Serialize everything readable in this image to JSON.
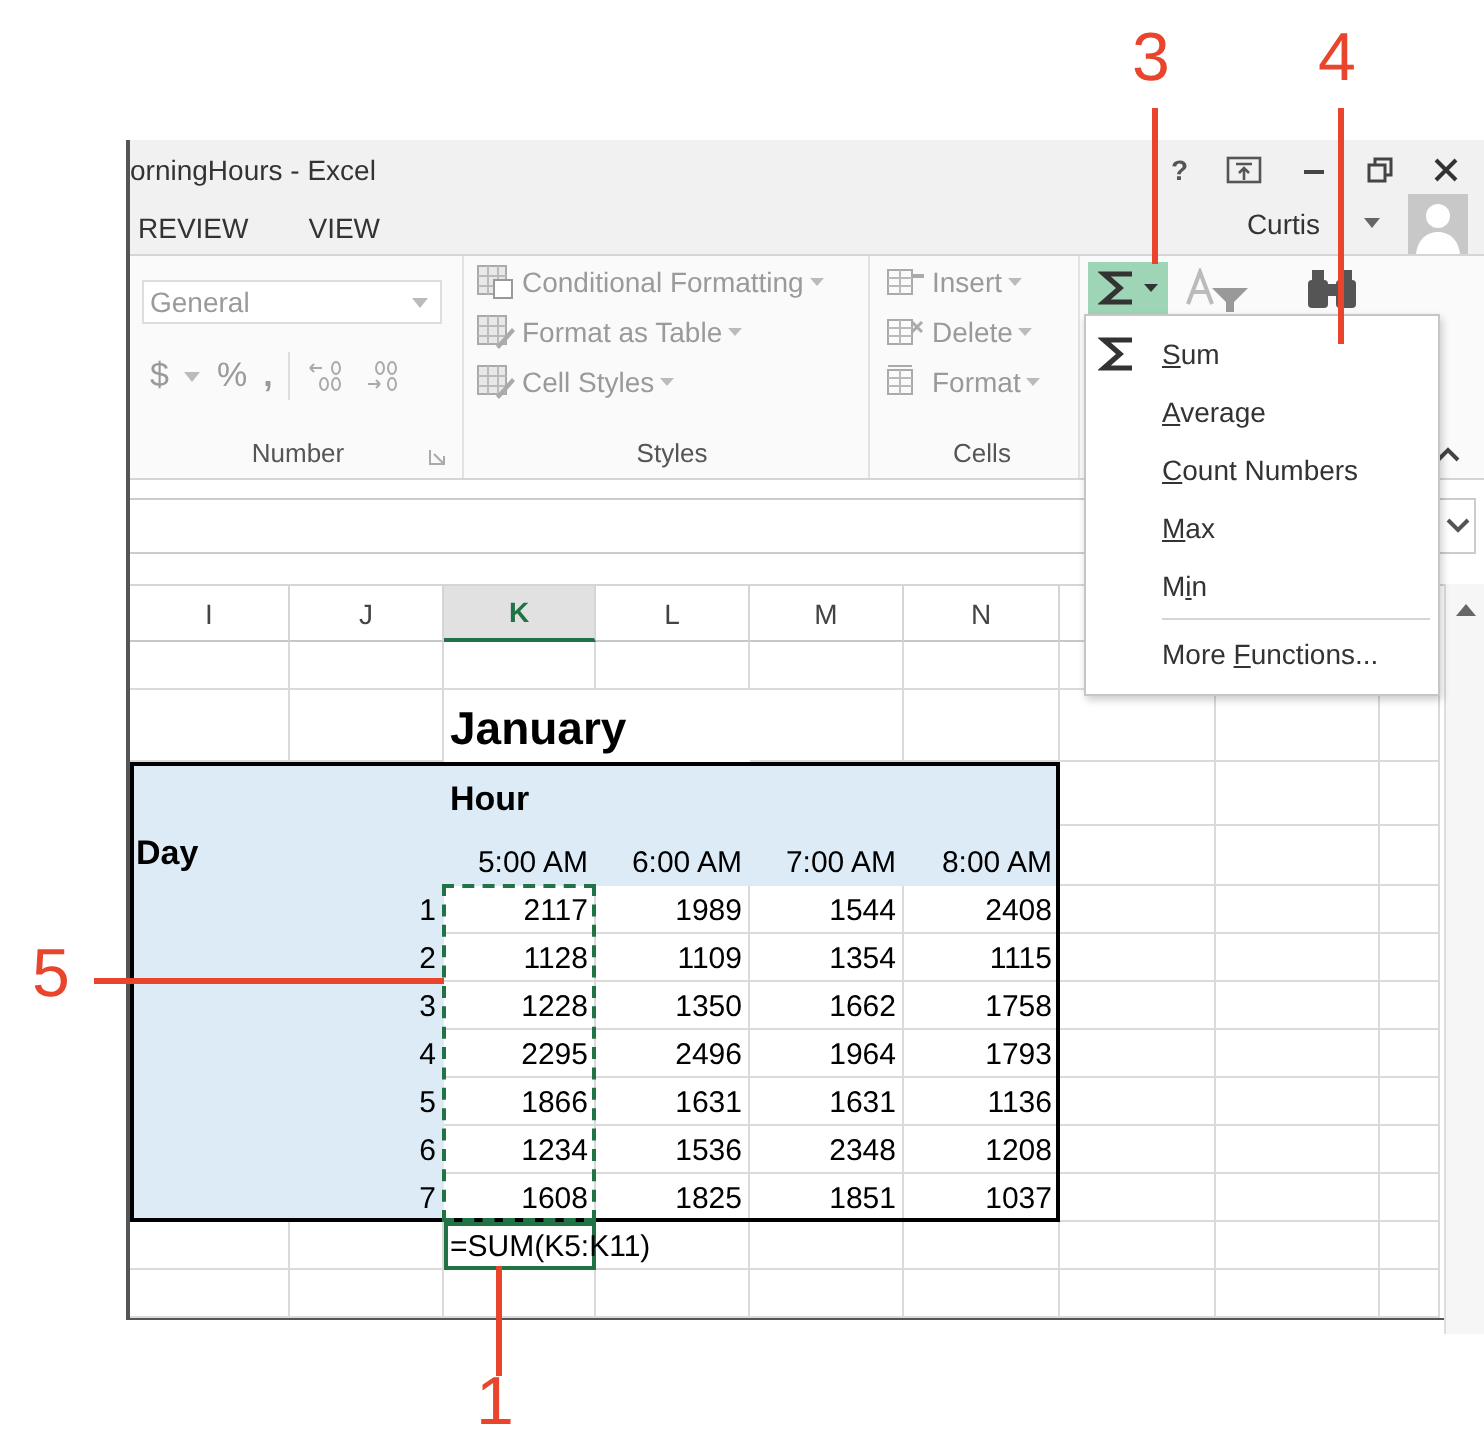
{
  "window": {
    "title": "orningHours - Excel",
    "help": "?"
  },
  "tabs": [
    {
      "label": "REVIEW",
      "selected": false
    },
    {
      "label": "VIEW",
      "selected": false
    }
  ],
  "account": {
    "name": "Curtis"
  },
  "ribbon": {
    "disabled": true,
    "number_group": {
      "format": "General",
      "currency": "$",
      "percent": "%",
      "comma": ",",
      "label": "Number"
    },
    "styles_group": {
      "items": [
        "Conditional Formatting",
        "Format as Table",
        "Cell Styles"
      ],
      "label": "Styles"
    },
    "cells_group": {
      "items": [
        "Insert",
        "Delete",
        "Format"
      ],
      "label": "Cells"
    },
    "autosum": {
      "expanded": true
    }
  },
  "autosum_menu": [
    {
      "kind": "icon",
      "key": "S",
      "after": "um"
    },
    {
      "kind": "plain",
      "key": "A",
      "after": "verage"
    },
    {
      "kind": "plain",
      "key": "C",
      "after": "ount Numbers"
    },
    {
      "kind": "plain",
      "key": "M",
      "after": "ax"
    },
    {
      "kind": "plain",
      "before": "M",
      "key": "i",
      "after": "n"
    },
    {
      "kind": "separator"
    },
    {
      "kind": "plain",
      "before": "More ",
      "key": "F",
      "after": "unctions..."
    }
  ],
  "sheet": {
    "column_headers": [
      {
        "label": "I",
        "selected": false
      },
      {
        "label": "J",
        "selected": false
      },
      {
        "label": "K",
        "selected": true
      },
      {
        "label": "L",
        "selected": false
      },
      {
        "label": "M",
        "selected": false
      },
      {
        "label": "N",
        "selected": false
      }
    ],
    "title": "January",
    "table": {
      "group_header": "Hour",
      "row_header": "Day",
      "columns": [
        "5:00 AM",
        "6:00 AM",
        "7:00 AM",
        "8:00 AM"
      ],
      "rows": [
        {
          "day": "1",
          "values": [
            "2117",
            "1989",
            "1544",
            "2408"
          ]
        },
        {
          "day": "2",
          "values": [
            "1128",
            "1109",
            "1354",
            "1115"
          ]
        },
        {
          "day": "3",
          "values": [
            "1228",
            "1350",
            "1662",
            "1758"
          ]
        },
        {
          "day": "4",
          "values": [
            "2295",
            "2496",
            "1964",
            "1793"
          ]
        },
        {
          "day": "5",
          "values": [
            "1866",
            "1631",
            "1631",
            "1136"
          ]
        },
        {
          "day": "6",
          "values": [
            "1234",
            "1536",
            "2348",
            "1208"
          ]
        },
        {
          "day": "7",
          "values": [
            "1608",
            "1825",
            "1851",
            "1037"
          ]
        }
      ]
    },
    "formula": "=SUM(K5:K11)"
  },
  "callouts": [
    {
      "label": "3"
    },
    {
      "label": "4"
    },
    {
      "label": "5"
    },
    {
      "label": "1"
    }
  ]
}
